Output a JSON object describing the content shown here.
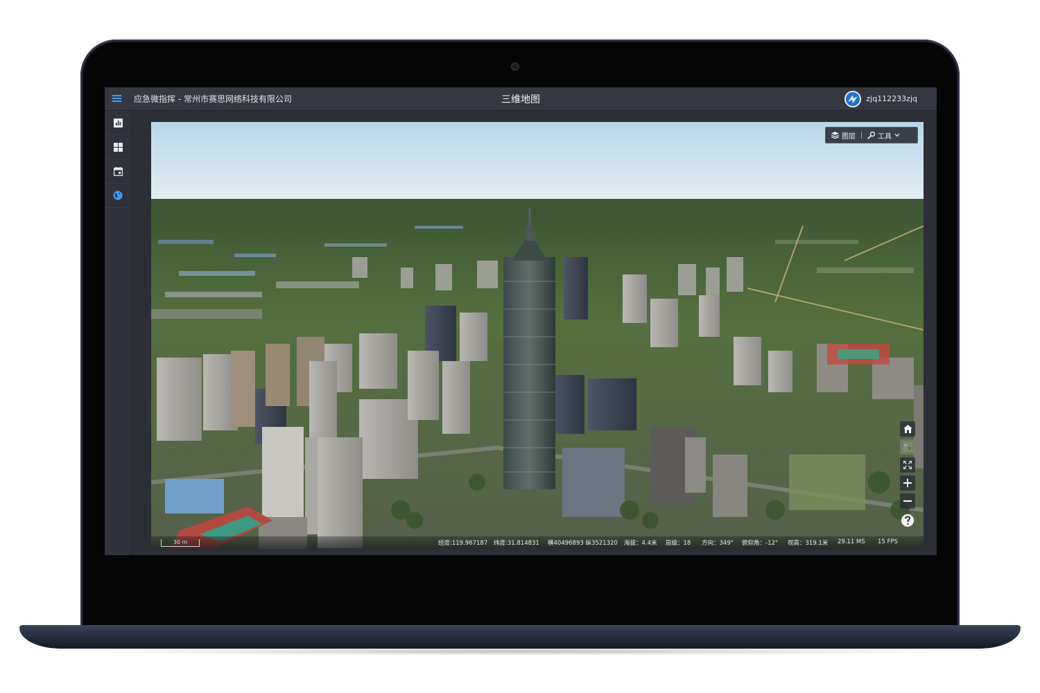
{
  "app": {
    "title": "应急微指挥 - 常州市赛思网络科技有限公司",
    "page_title": "三维地图",
    "username": "zjq112233zjq"
  },
  "sidebar": {
    "items": [
      {
        "name": "chart-icon",
        "active": false
      },
      {
        "name": "dashboard-icon",
        "active": false
      },
      {
        "name": "calendar-icon",
        "active": false
      },
      {
        "name": "globe-icon",
        "active": true
      }
    ]
  },
  "toolbar": {
    "layers_label": "图层",
    "tools_label": "工具"
  },
  "map": {
    "scale_label": "30 m",
    "status": {
      "longitude": "经度:119.967187",
      "latitude": "纬度:31.814831",
      "projected": "横40496893 纵3521320",
      "altitude": "海拔：4.4米",
      "level": "层级：18",
      "heading": "方向：349°",
      "pitch": "俯仰角：-12°",
      "view_height": "视高：319.1米",
      "latency": "29.11 MS",
      "fps": "15 FPS"
    }
  },
  "colors": {
    "accent": "#3aa1ff",
    "topbar": "#353841",
    "sidebar": "#30333b"
  }
}
